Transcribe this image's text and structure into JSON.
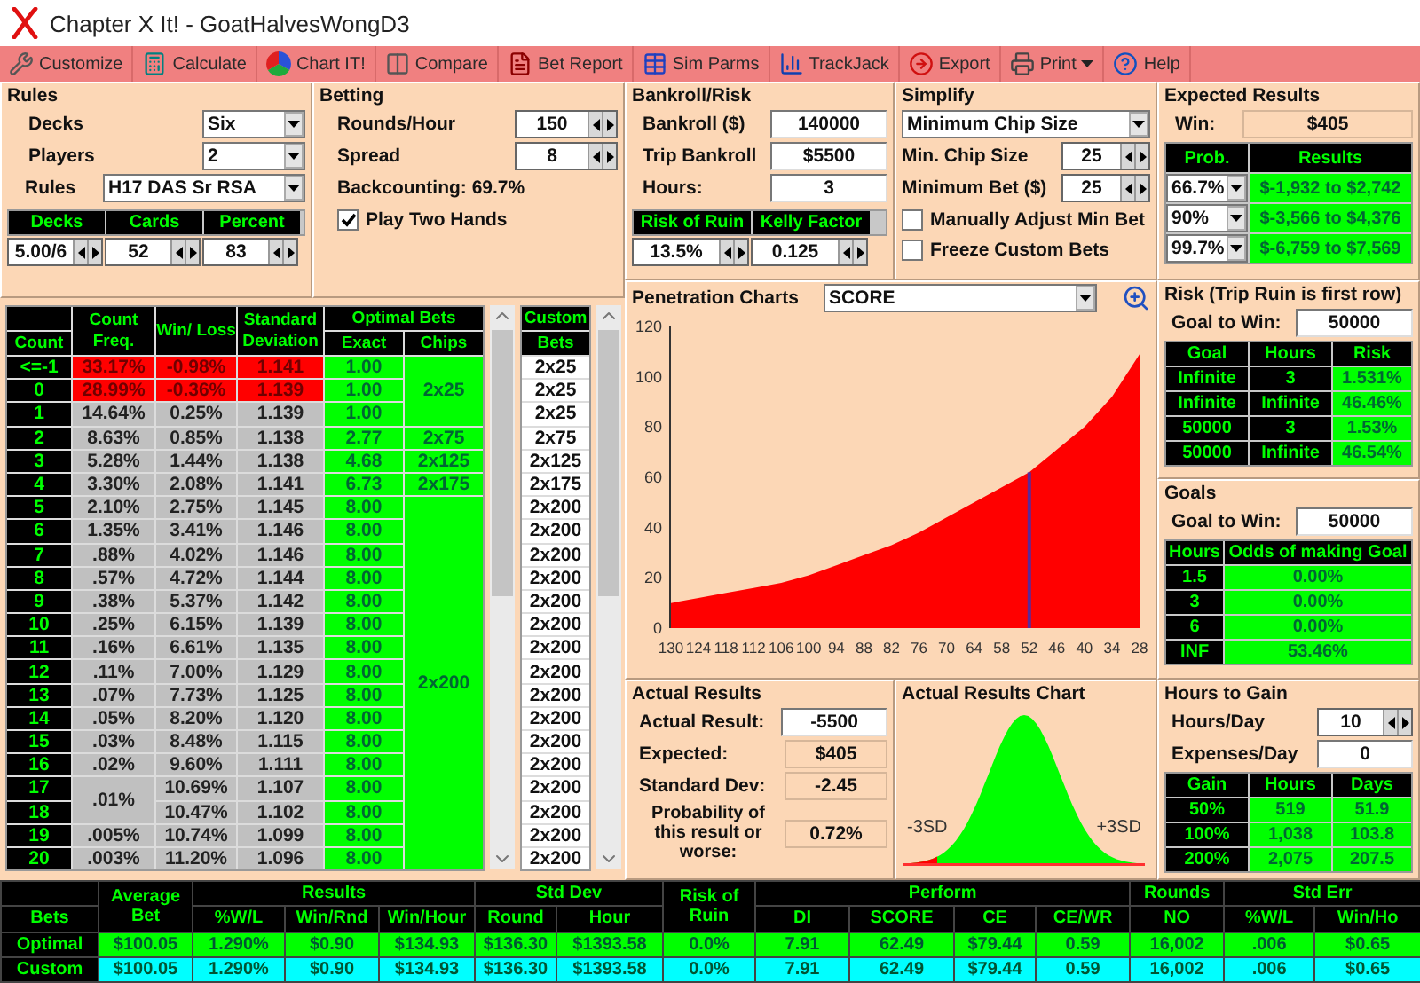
{
  "window": {
    "title": "Chapter X It! - GoatHalvesWongD3"
  },
  "toolbar": [
    {
      "label": "Customize"
    },
    {
      "label": "Calculate"
    },
    {
      "label": "Chart IT!"
    },
    {
      "label": "Compare"
    },
    {
      "label": "Bet Report"
    },
    {
      "label": "Sim Parms"
    },
    {
      "label": "TrackJack"
    },
    {
      "label": "Export"
    },
    {
      "label": "Print",
      "has_menu": true
    },
    {
      "label": "Help"
    }
  ],
  "rules": {
    "title": "Rules",
    "fields": [
      {
        "label": "Decks",
        "value": "Six",
        "wide": false
      },
      {
        "label": "Players",
        "value": "2",
        "wide": false
      },
      {
        "label": "Rules",
        "value": "H17 DAS Sr RSA",
        "wide": true
      }
    ],
    "pen_table": {
      "columns": [
        "Decks",
        "Cards",
        "Percent"
      ],
      "values": [
        "5.00/6",
        "52",
        "83"
      ]
    }
  },
  "betting": {
    "title": "Betting",
    "fields": [
      {
        "label": "Rounds/Hour",
        "value": "150"
      },
      {
        "label": "Spread",
        "value": "8"
      }
    ],
    "backcounting": "Backcounting: 69.7%",
    "play_two_hands": {
      "label": "Play Two Hands",
      "checked": true
    }
  },
  "bankroll": {
    "title": "Bankroll/Risk",
    "fields": [
      {
        "label": "Bankroll ($)",
        "value": "140000"
      },
      {
        "label": "Trip Bankroll",
        "value": "$5500"
      },
      {
        "label": "Hours:",
        "value": "3"
      }
    ],
    "ror": {
      "columns": [
        "Risk of Ruin",
        "Kelly Factor"
      ],
      "values": [
        "13.5%",
        "0.125"
      ]
    }
  },
  "simplify": {
    "title": "Simplify",
    "mode": "Minimum Chip Size",
    "fields": [
      {
        "label": "Min. Chip Size",
        "value": "25"
      },
      {
        "label": "Minimum Bet ($)",
        "value": "25"
      }
    ],
    "options": [
      {
        "label": "Manually Adjust Min Bet",
        "checked": false
      },
      {
        "label": "Freeze Custom Bets",
        "checked": false
      }
    ]
  },
  "expected": {
    "title": "Expected Results",
    "win_label": "Win:",
    "win": "$405",
    "columns": [
      "Prob.",
      "Results"
    ],
    "rows": [
      {
        "prob": "66.7%",
        "result": "$-1,932 to $2,742"
      },
      {
        "prob": "90%",
        "result": "$-3,566 to $4,376"
      },
      {
        "prob": "99.7%",
        "result": "$-6,759 to $7,569"
      }
    ]
  },
  "count_table": {
    "headers": {
      "count": "Count",
      "freq": "Count Freq.",
      "winloss": "Win/ Loss",
      "sd": "Standard Deviation",
      "optimal": "Optimal Bets",
      "exact": "Exact",
      "chips": "Chips"
    },
    "rows": [
      {
        "count": "<=-1",
        "freq": "33.17%",
        "winloss": "-0.98%",
        "sd": "1.141",
        "exact": "1.00",
        "chips": "2x25",
        "highlight": true
      },
      {
        "count": "0",
        "freq": "28.99%",
        "winloss": "-0.36%",
        "sd": "1.139",
        "exact": "1.00",
        "highlight": true
      },
      {
        "count": "1",
        "freq": "14.64%",
        "winloss": "0.25%",
        "sd": "1.139",
        "exact": "1.00",
        "highlight": false
      },
      {
        "count": "2",
        "freq": "8.63%",
        "winloss": "0.85%",
        "sd": "1.138",
        "exact": "2.77",
        "chips": "2x75",
        "highlight": false
      },
      {
        "count": "3",
        "freq": "5.28%",
        "winloss": "1.44%",
        "sd": "1.138",
        "exact": "4.68",
        "chips": "2x125",
        "highlight": false
      },
      {
        "count": "4",
        "freq": "3.30%",
        "winloss": "2.08%",
        "sd": "1.141",
        "exact": "6.73",
        "chips": "2x175",
        "highlight": false
      },
      {
        "count": "5",
        "freq": "2.10%",
        "winloss": "2.75%",
        "sd": "1.145",
        "exact": "8.00",
        "chips": "2x200",
        "highlight": false
      },
      {
        "count": "6",
        "freq": "1.35%",
        "winloss": "3.41%",
        "sd": "1.146",
        "exact": "8.00",
        "highlight": false
      },
      {
        "count": "7",
        "freq": ".88%",
        "winloss": "4.02%",
        "sd": "1.146",
        "exact": "8.00",
        "highlight": false
      },
      {
        "count": "8",
        "freq": ".57%",
        "winloss": "4.72%",
        "sd": "1.144",
        "exact": "8.00",
        "highlight": false
      },
      {
        "count": "9",
        "freq": ".38%",
        "winloss": "5.37%",
        "sd": "1.142",
        "exact": "8.00",
        "highlight": false
      },
      {
        "count": "10",
        "freq": ".25%",
        "winloss": "6.15%",
        "sd": "1.139",
        "exact": "8.00",
        "highlight": false
      },
      {
        "count": "11",
        "freq": ".16%",
        "winloss": "6.61%",
        "sd": "1.135",
        "exact": "8.00",
        "highlight": false
      },
      {
        "count": "12",
        "freq": ".11%",
        "winloss": "7.00%",
        "sd": "1.129",
        "exact": "8.00",
        "highlight": false
      },
      {
        "count": "13",
        "freq": ".07%",
        "winloss": "7.73%",
        "sd": "1.125",
        "exact": "8.00",
        "highlight": false
      },
      {
        "count": "14",
        "freq": ".05%",
        "winloss": "8.20%",
        "sd": "1.120",
        "exact": "8.00",
        "highlight": false
      },
      {
        "count": "15",
        "freq": ".03%",
        "winloss": "8.48%",
        "sd": "1.115",
        "exact": "8.00",
        "highlight": false
      },
      {
        "count": "16",
        "freq": ".02%",
        "winloss": "9.60%",
        "sd": "1.111",
        "exact": "8.00",
        "highlight": false
      },
      {
        "count": "17",
        "freq": ".01%",
        "winloss": "10.69%",
        "sd": "1.107",
        "exact": "8.00",
        "highlight": false
      },
      {
        "count": "18",
        "winloss": "10.47%",
        "sd": "1.102",
        "exact": "8.00",
        "highlight": false
      },
      {
        "count": "19",
        "freq": ".005%",
        "winloss": "10.74%",
        "sd": "1.099",
        "exact": "8.00",
        "highlight": false
      },
      {
        "count": "20",
        "freq": ".003%",
        "winloss": "11.20%",
        "sd": "1.096",
        "exact": "8.00",
        "highlight": false
      }
    ]
  },
  "custom_bets": {
    "header": [
      "Custom",
      "Bets"
    ],
    "values": [
      "2x25",
      "2x25",
      "2x25",
      "2x75",
      "2x125",
      "2x175",
      "2x200",
      "2x200",
      "2x200",
      "2x200",
      "2x200",
      "2x200",
      "2x200",
      "2x200",
      "2x200",
      "2x200",
      "2x200",
      "2x200",
      "2x200",
      "2x200",
      "2x200",
      "2x200"
    ]
  },
  "penetration": {
    "title": "Penetration Charts",
    "metric": "SCORE",
    "chart_data": {
      "type": "area",
      "categories": [
        "130",
        "124",
        "118",
        "112",
        "106",
        "100",
        "94",
        "88",
        "82",
        "76",
        "70",
        "64",
        "58",
        "52",
        "46",
        "40",
        "34",
        "28"
      ],
      "series": [
        {
          "color": "#ff0000",
          "values": [
            10,
            12,
            14,
            16,
            18,
            21,
            25,
            29,
            33,
            38,
            44,
            50,
            56,
            62,
            71,
            80,
            92,
            109
          ]
        }
      ],
      "ylim": [
        0,
        120
      ],
      "yticks": [
        0,
        20,
        40,
        60,
        80,
        100,
        120
      ],
      "ref_lines": [
        {
          "axis": "x",
          "value": "52"
        }
      ]
    }
  },
  "risk": {
    "title": "Risk (Trip Ruin is first row)",
    "goal_label": "Goal to Win:",
    "goal": "50000",
    "columns": [
      "Goal",
      "Hours",
      "Risk"
    ],
    "rows": [
      [
        "Infinite",
        "3",
        "1.531%"
      ],
      [
        "Infinite",
        "Infinite",
        "46.46%"
      ],
      [
        "50000",
        "3",
        "1.53%"
      ],
      [
        "50000",
        "Infinite",
        "46.54%"
      ]
    ]
  },
  "goals": {
    "title": "Goals",
    "goal_label": "Goal to Win:",
    "goal": "50000",
    "columns": [
      "Hours",
      "Odds of making Goal"
    ],
    "rows": [
      [
        "1.5",
        "0.00%"
      ],
      [
        "3",
        "0.00%"
      ],
      [
        "6",
        "0.00%"
      ],
      [
        "INF",
        "53.46%"
      ]
    ]
  },
  "actual": {
    "title": "Actual Results",
    "fields": [
      {
        "label": "Actual Result:",
        "value": "-5500",
        "kind": "input"
      },
      {
        "label": "Expected:",
        "value": "$405",
        "kind": "display"
      },
      {
        "label": "Standard Dev:",
        "value": "-2.45",
        "kind": "display"
      },
      {
        "label": "Probability of this result or worse:",
        "value": "0.72%",
        "kind": "display"
      }
    ]
  },
  "actual_chart": {
    "title": "Actual Results Chart",
    "left_label": "-3SD",
    "right_label": "+3SD"
  },
  "hours_to_gain": {
    "title": "Hours to Gain",
    "fields": [
      {
        "label": "Hours/Day",
        "value": "10",
        "kind": "spinner"
      },
      {
        "label": "Expenses/Day",
        "value": "0",
        "kind": "input"
      }
    ],
    "columns": [
      "Gain",
      "Hours",
      "Days"
    ],
    "rows": [
      [
        "50%",
        "519",
        "51.9"
      ],
      [
        "100%",
        "1,038",
        "103.8"
      ],
      [
        "200%",
        "2,075",
        "207.5"
      ]
    ]
  },
  "summary": {
    "groups": [
      {
        "columns": [
          "Bets"
        ]
      },
      {
        "label": "Average Bet"
      },
      {
        "label": "Results",
        "columns": [
          "%W/L",
          "Win/Rnd",
          "Win/Hour"
        ]
      },
      {
        "label": "Std Dev",
        "columns": [
          "Round",
          "Hour"
        ]
      },
      {
        "label": "Risk of Ruin"
      },
      {
        "label": "Perform",
        "columns": [
          "DI",
          "SCORE",
          "CE",
          "CE/WR"
        ]
      },
      {
        "label": "Rounds",
        "columns": [
          "NO"
        ]
      },
      {
        "label": "Std Err",
        "columns": [
          "%W/L",
          "Win/Ho"
        ]
      }
    ],
    "rows": [
      {
        "label": "Optimal",
        "color": "#00ff00",
        "cells": [
          "$100.05",
          "1.290%",
          "$0.90",
          "$134.93",
          "$136.30",
          "$1393.58",
          "0.0%",
          "7.91",
          "62.49",
          "$79.44",
          "0.59",
          "16,002",
          ".006",
          "$0.65"
        ]
      },
      {
        "label": "Custom",
        "color": "#00ffff",
        "cells": [
          "$100.05",
          "1.290%",
          "$0.90",
          "$134.93",
          "$136.30",
          "$1393.58",
          "0.0%",
          "7.91",
          "62.49",
          "$79.44",
          "0.59",
          "16,002",
          ".006",
          "$0.65"
        ]
      }
    ]
  }
}
